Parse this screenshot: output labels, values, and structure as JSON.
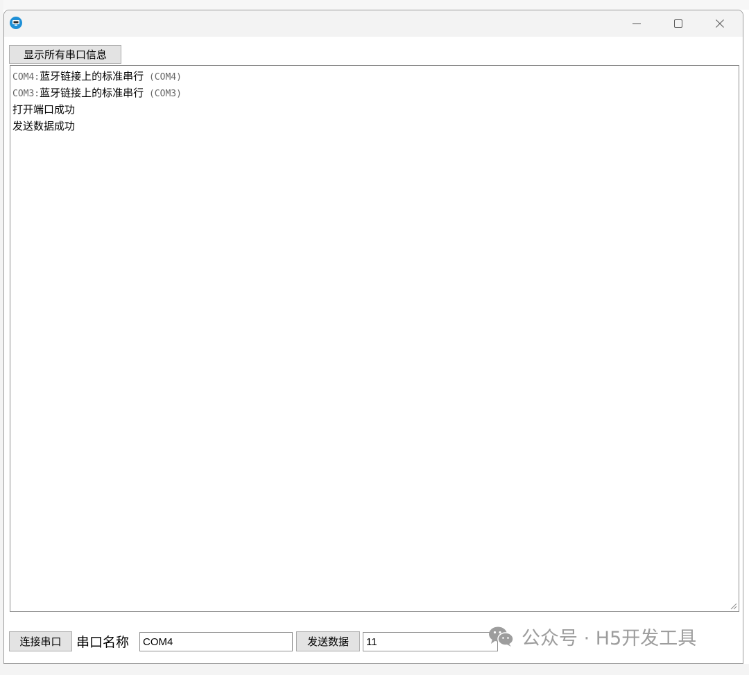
{
  "toolbar": {
    "show_all_label": "显示所有串口信息"
  },
  "log": {
    "lines": [
      {
        "port": "COM4:",
        "desc": "蓝牙链接上的标准串行",
        "suffix": " (COM4)"
      },
      {
        "port": "COM3:",
        "desc": "蓝牙链接上的标准串行",
        "suffix": " (COM3)"
      },
      {
        "text": "打开端口成功"
      },
      {
        "text": "发送数据成功"
      }
    ]
  },
  "bottom": {
    "connect_label": "连接串口",
    "port_name_label": "串口名称",
    "port_name_value": "COM4",
    "send_label": "发送数据",
    "send_value": "11"
  },
  "watermark": {
    "text": "公众号 · H5开发工具"
  }
}
